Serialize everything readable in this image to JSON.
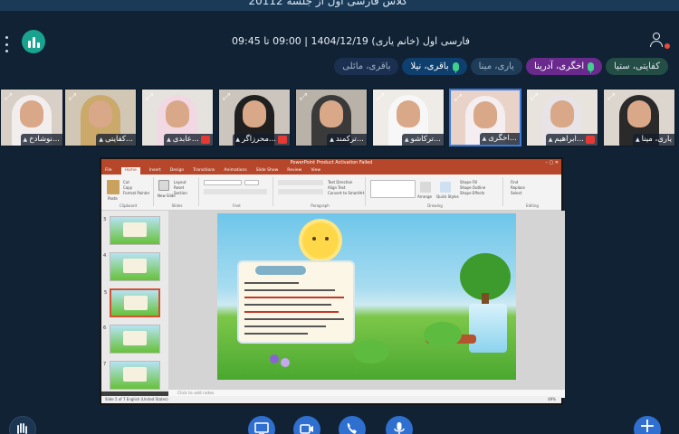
{
  "window": {
    "top_title": "کلاس فارسی اول از جلسه 20112"
  },
  "header": {
    "meeting_title": "فارسی اول (خانم یاری) 1404/12/19 | 09:00 تا 09:45",
    "chips": [
      {
        "label": "کفایتی، ستیا",
        "style": "green"
      },
      {
        "label": "اخگری، آدرینا",
        "style": "purple",
        "mic": true
      },
      {
        "label": "یاری، مینا",
        "style": "dark"
      },
      {
        "label": "باقری، نیلا",
        "style": "blue",
        "mic": true
      },
      {
        "label": "باقری، مائلی",
        "style": "navy"
      }
    ]
  },
  "tiles": [
    {
      "name": "یاری، مینا",
      "muted": false,
      "active": false
    },
    {
      "name": "ابراهیم...",
      "muted": true,
      "active": false
    },
    {
      "name": "اخگری...",
      "muted": false,
      "active": true
    },
    {
      "name": "ترکاشو...",
      "muted": false,
      "active": false
    },
    {
      "name": "ترکمند...",
      "muted": false,
      "active": false
    },
    {
      "name": "محرزاگر...",
      "muted": true,
      "active": false
    },
    {
      "name": "عابدی...",
      "muted": true,
      "active": false
    },
    {
      "name": "کفایتی...",
      "muted": false,
      "active": false
    },
    {
      "name": "نوشادخ...",
      "muted": false,
      "active": false
    }
  ],
  "powerpoint": {
    "title": "PowerPoint Product Activation Failed",
    "tabs": [
      "File",
      "Home",
      "Insert",
      "Design",
      "Transitions",
      "Animations",
      "Slide Show",
      "Review",
      "View"
    ],
    "active_tab": "Home",
    "ribbon_groups": [
      "Clipboard",
      "Slides",
      "Font",
      "Paragraph",
      "Drawing",
      "Editing"
    ],
    "ribbon_labels": {
      "paste": "Paste",
      "cut": "Cut",
      "copy": "Copy",
      "format_painter": "Format Painter",
      "new_slide": "New Slide",
      "layout": "Layout",
      "reset": "Reset",
      "section": "Section",
      "find": "Find",
      "replace": "Replace",
      "select": "Select",
      "arrange": "Arrange",
      "quick_styles": "Quick Styles",
      "shape_fill": "Shape Fill",
      "shape_outline": "Shape Outline",
      "shape_effects": "Shape Effects",
      "text_direction": "Text Direction",
      "align_text": "Align Text",
      "convert_smartart": "Convert to SmartArt"
    },
    "thumb_numbers": [
      "3",
      "4",
      "5",
      "6",
      "7"
    ],
    "notes_placeholder": "Click to add notes",
    "status": "Slide 5 of 7    English (United States)",
    "zoom": "49%"
  },
  "controls": {
    "share": "screen-share-icon",
    "camera": "camera-icon",
    "phone": "phone-icon",
    "mic": "microphone-icon"
  }
}
